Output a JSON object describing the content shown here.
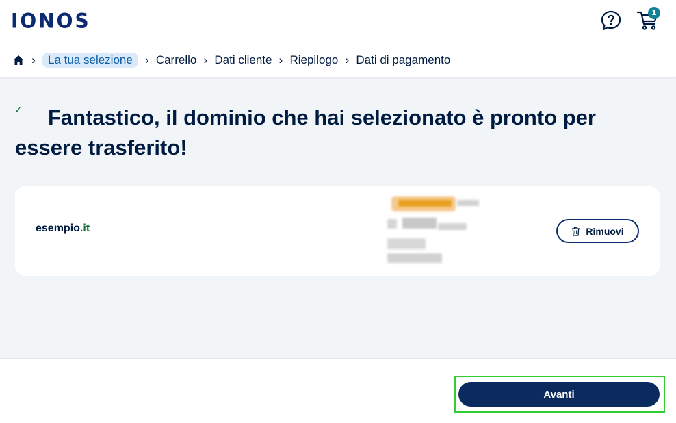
{
  "header": {
    "logo_text": "IONOS",
    "help_icon": "help-chat-icon",
    "cart_icon": "cart-icon",
    "cart_count": "1"
  },
  "breadcrumb": {
    "home_icon": "home-icon",
    "items": [
      {
        "label": "La tua selezione",
        "active": true
      },
      {
        "label": "Carrello",
        "active": false
      },
      {
        "label": "Dati cliente",
        "active": false
      },
      {
        "label": "Riepilogo",
        "active": false
      },
      {
        "label": "Dati di pagamento",
        "active": false
      }
    ]
  },
  "main": {
    "check_icon": "check-icon",
    "heading": "Fantastico, il dominio che hai selezionato è pronto per essere trasferito!",
    "domain": {
      "name": "esempio",
      "tld": ".it"
    },
    "remove_label": "Rimuovi",
    "remove_icon": "trash-icon"
  },
  "footer": {
    "next_label": "Avanti"
  },
  "colors": {
    "brand_navy": "#0b2a5e",
    "accent_teal": "#11829a",
    "highlight_green": "#33cc33",
    "tld_green": "#1a6b3a"
  }
}
